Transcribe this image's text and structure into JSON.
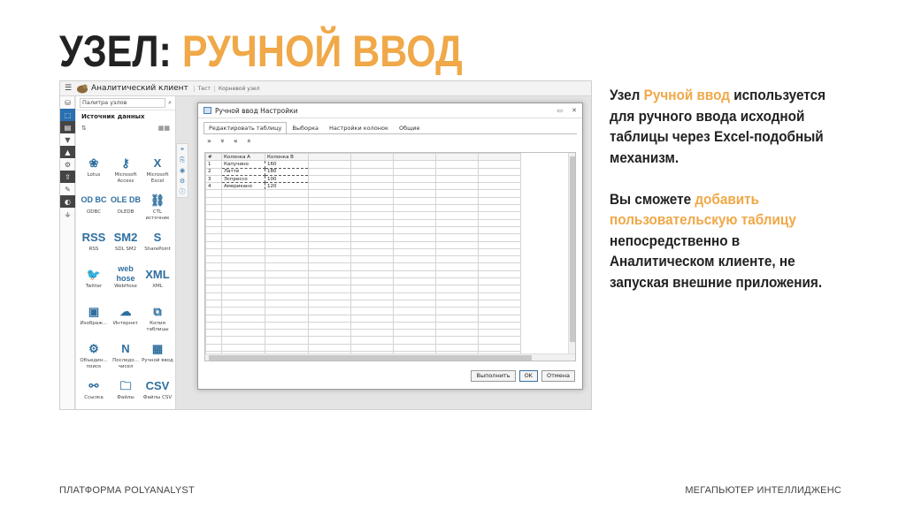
{
  "slide": {
    "title_part1": "УЗЕЛ:",
    "title_part2": "РУЧНОЙ ВВОД",
    "accent_color": "#F0A848",
    "paragraph1": {
      "before": "Узел ",
      "highlight": "Ручной ввод",
      "after": " используется для ручного ввода исходной таблицы через Excel-подобный механизм."
    },
    "paragraph2": {
      "before": "Вы сможете ",
      "highlight": "добавить пользовательскую таблицу",
      "after": " непосредственно в Аналитическом клиенте, не запуская внешние приложения."
    },
    "footer_left": "ПЛАТФОРМА POLYANALYST",
    "footer_right": "МЕГАПЬЮТЕР ИНТЕЛЛИДЖЕНС"
  },
  "app": {
    "app_name": "Аналитический клиент",
    "breadcrumbs": [
      "Тест",
      "Корневой узел"
    ],
    "palette_title": "Палитра узлов",
    "source_label": "Источник данных",
    "nodes": [
      {
        "label": "Lotus",
        "icon": "lotus-icon",
        "glyph": "❀"
      },
      {
        "label": "Microsoft Access",
        "icon": "access-key-icon",
        "glyph": "⚷"
      },
      {
        "label": "Microsoft Excel",
        "icon": "excel-icon",
        "glyph": "X"
      },
      {
        "label": "ODBC",
        "icon": "odbc-icon",
        "glyph": "OD BC"
      },
      {
        "label": "OLEDB",
        "icon": "oledb-icon",
        "glyph": "OLE DB"
      },
      {
        "label": "CTL источник",
        "icon": "ctl-link-icon",
        "glyph": "⛓"
      },
      {
        "label": "RSS",
        "icon": "rss-icon",
        "glyph": "RSS"
      },
      {
        "label": "SDL SM2",
        "icon": "sdl-sm2-icon",
        "glyph": "SM2"
      },
      {
        "label": "SharePoint",
        "icon": "sharepoint-icon",
        "glyph": "S"
      },
      {
        "label": "Twitter",
        "icon": "twitter-icon",
        "glyph": "🐦"
      },
      {
        "label": "WebHose",
        "icon": "webhose-icon",
        "glyph": "web hose"
      },
      {
        "label": "XML",
        "icon": "xml-icon",
        "glyph": "XML"
      },
      {
        "label": "Изображ...",
        "icon": "image-icon",
        "glyph": "▣"
      },
      {
        "label": "Интернет",
        "icon": "internet-icon",
        "glyph": "☁"
      },
      {
        "label": "Копия таблицы",
        "icon": "table-copy-icon",
        "glyph": "⧉"
      },
      {
        "label": "Объедин... поиск",
        "icon": "federated-search-icon",
        "glyph": "⚙"
      },
      {
        "label": "Последо... чисел",
        "icon": "number-sequence-icon",
        "glyph": "N"
      },
      {
        "label": "Ручной ввод",
        "icon": "manual-input-grid-icon",
        "glyph": "▦"
      },
      {
        "label": "Ссылка",
        "icon": "link-icon",
        "glyph": "⚯"
      },
      {
        "label": "Файлы",
        "icon": "files-icon",
        "glyph": "🗀"
      },
      {
        "label": "Файлы CSV",
        "icon": "csv-icon",
        "glyph": "CSV"
      }
    ]
  },
  "dialog": {
    "title": "Ручной ввод Настройки",
    "tabs": [
      "Редактировать таблицу",
      "Выборка",
      "Настройки колонок",
      "Общие"
    ],
    "toolbar": [
      "»",
      "»",
      "«",
      "«"
    ],
    "columns": [
      "#",
      "Колонка A",
      "Колонка B"
    ],
    "rows": [
      [
        "1",
        "Капучино",
        "160"
      ],
      [
        "2",
        "Латте",
        "180"
      ],
      [
        "3",
        "Эспрессо",
        "100"
      ],
      [
        "4",
        "Американо",
        "120"
      ]
    ],
    "buttons": [
      "Выполнить",
      "OK",
      "Отмена"
    ]
  }
}
